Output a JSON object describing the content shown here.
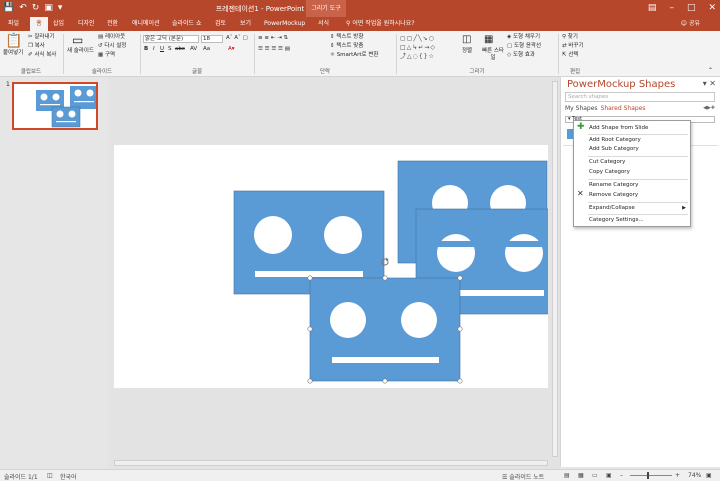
{
  "app": {
    "title": "프레젠테이션1 - PowerPoint",
    "contextual_tab_group": "그리기 도구",
    "tell_me": "어떤 작업을 원하시나요?",
    "share": "공유"
  },
  "tabs": [
    "파일",
    "홈",
    "삽입",
    "디자인",
    "전환",
    "애니메이션",
    "슬라이드 쇼",
    "검토",
    "보기",
    "PowerMockup",
    "서식"
  ],
  "ribbon": {
    "clipboard": {
      "paste": "붙여넣기",
      "cut": "잘라내기",
      "copy": "복사",
      "format_painter": "서식 복사",
      "label": "클립보드"
    },
    "slides": {
      "new_slide": "새 슬라이드",
      "layout": "레이아웃",
      "reset": "다시 설정",
      "section": "구역",
      "label": "슬라이드"
    },
    "font": {
      "font_name": "맑은 고딕 (본문)",
      "font_size": "18",
      "label": "글꼴"
    },
    "paragraph": {
      "text_direction": "텍스트 방향",
      "align_text": "텍스트 맞춤",
      "smartart": "SmartArt로 변환",
      "label": "단락"
    },
    "drawing": {
      "arrange": "정렬",
      "quick_styles": "빠른 스타일",
      "shape_fill": "도형 채우기",
      "shape_outline": "도형 윤곽선",
      "shape_effects": "도형 효과",
      "label": "그리기"
    },
    "editing": {
      "find": "찾기",
      "replace": "바꾸기",
      "select": "선택",
      "label": "편집"
    }
  },
  "thumbnail": {
    "number": "1"
  },
  "panel": {
    "title": "PowerMockup Shapes",
    "search_placeholder": "Search shapes",
    "tab_my": "My Shapes",
    "tab_shared": "Shared Shapes",
    "category": "Test"
  },
  "context_menu": {
    "items": [
      "Add Shape from Slide",
      "Add Root Category",
      "Add Sub Category",
      "Cut Category",
      "Copy Category",
      "Rename Category",
      "Remove Category",
      "Expand/Collapse",
      "Category Settings..."
    ]
  },
  "status": {
    "slide": "슬라이드 1/1",
    "language": "한국어",
    "notes": "슬라이드 노트",
    "zoom": "74%"
  },
  "colors": {
    "accent": "#b7472a",
    "shape_fill": "#5b9bd5",
    "shape_stroke": "#41719c"
  }
}
